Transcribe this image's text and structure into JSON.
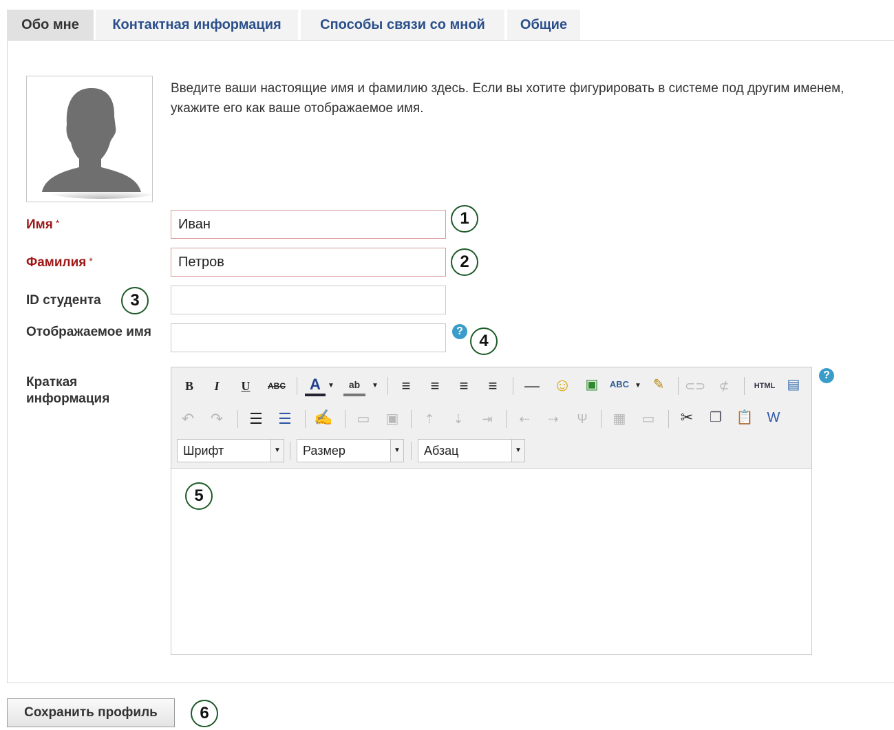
{
  "tabs": [
    {
      "label": "Обо мне",
      "active": true
    },
    {
      "label": "Контактная информация",
      "active": false
    },
    {
      "label": "Способы связи со мной",
      "active": false
    },
    {
      "label": "Общие",
      "active": false
    }
  ],
  "intro": "Введите ваши настоящие имя и фамилию здесь. Если вы хотите фигурировать в системе под другим именем, укажите его как ваше отображаемое имя.",
  "fields": {
    "first_name": {
      "label": "Имя",
      "required_mark": "*",
      "value": "Иван"
    },
    "last_name": {
      "label": "Фамилия",
      "required_mark": "*",
      "value": "Петров"
    },
    "student_id": {
      "label": "ID студента",
      "value": ""
    },
    "display_name": {
      "label": "Отображаемое имя",
      "value": ""
    },
    "intro_text": {
      "label": "Краткая информация"
    }
  },
  "help_glyph": "?",
  "editor": {
    "font_select": "Шрифт",
    "size_select": "Размер",
    "format_select": "Абзац"
  },
  "callouts": [
    "1",
    "2",
    "3",
    "4",
    "5",
    "6"
  ],
  "save_button": "Сохранить профиль",
  "colors": {
    "required_label": "#a01818",
    "tab_link": "#2a4f8a",
    "callout_border": "#1c5a26",
    "help_icon": "#3a9cc8"
  }
}
